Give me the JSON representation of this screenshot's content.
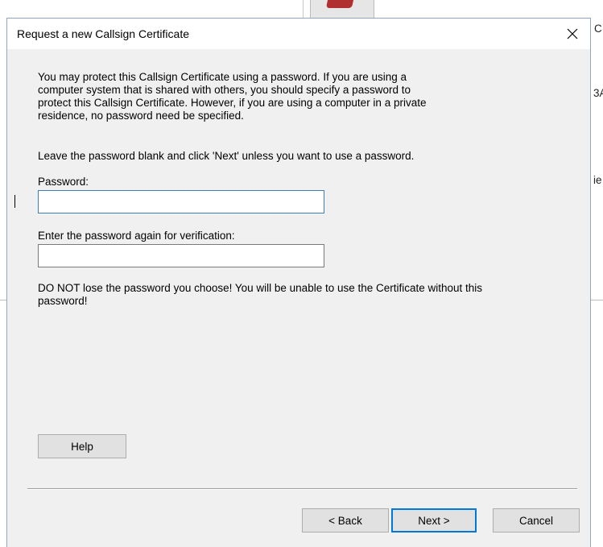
{
  "background": {
    "fragments": [
      "C",
      "3A",
      "ie"
    ]
  },
  "dialog": {
    "title": "Request a new Callsign Certificate",
    "intro_lines": [
      "You may protect this Callsign Certificate using a password. If you are using a",
      "computer system that is shared with others, you should specify a password to",
      "protect this Callsign Certificate. However, if you are using a computer in a private",
      "residence, no password need be specified."
    ],
    "instruction": "Leave the password blank and click 'Next' unless you want to use a password.",
    "password_label": "Password:",
    "password_value": "",
    "verify_label": "Enter the password again for verification:",
    "verify_value": "",
    "warning_lines": [
      "DO NOT lose the password you choose! You will be unable to use the Certificate without this",
      "password!"
    ],
    "buttons": {
      "help": "Help",
      "back": "< Back",
      "next": "Next >",
      "cancel": "Cancel"
    }
  }
}
